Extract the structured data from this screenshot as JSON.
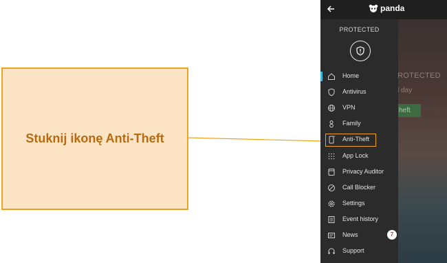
{
  "callout": {
    "text": "Stuknij ikonę Anti-Theft"
  },
  "app": {
    "brand": "panda"
  },
  "drawer": {
    "status": "PROTECTED"
  },
  "background": {
    "status": "ROTECTED",
    "subtitle": "l day",
    "button": "heft"
  },
  "menu": [
    {
      "label": "Home",
      "icon": "home-icon",
      "active": true
    },
    {
      "label": "Antivirus",
      "icon": "shield-icon"
    },
    {
      "label": "VPN",
      "icon": "vpn-globe-icon"
    },
    {
      "label": "Family",
      "icon": "family-icon"
    },
    {
      "label": "Anti-Theft",
      "icon": "phone-icon",
      "highlighted": true
    },
    {
      "label": "App Lock",
      "icon": "keypad-icon"
    },
    {
      "label": "Privacy Auditor",
      "icon": "privacy-icon"
    },
    {
      "label": "Call Blocker",
      "icon": "call-blocker-icon"
    },
    {
      "label": "Settings",
      "icon": "gear-icon"
    },
    {
      "label": "Event history",
      "icon": "history-icon"
    },
    {
      "label": "News",
      "icon": "news-icon",
      "badge": "7"
    },
    {
      "label": "Support",
      "icon": "support-icon"
    }
  ],
  "colors": {
    "highlight": "#f0a21f",
    "active": "#3fb8d8",
    "callout_bg": "#fce4c4",
    "callout_text": "#b86a10"
  }
}
